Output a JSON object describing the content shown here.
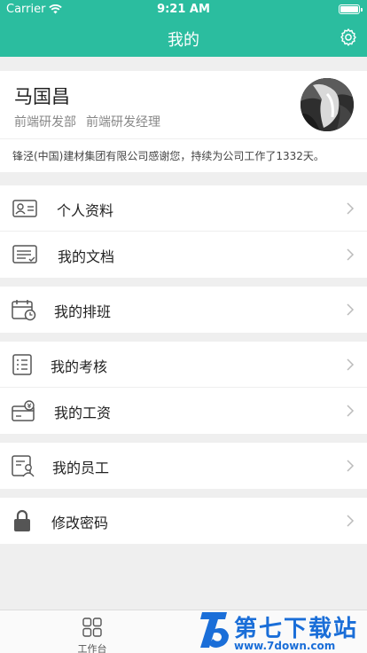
{
  "status_bar": {
    "carrier": "Carrier",
    "time": "9:21 AM",
    "battery_level": 1.0
  },
  "nav": {
    "title": "我的",
    "settings_icon": "gear-icon"
  },
  "profile": {
    "name": "马国昌",
    "department": "前端研发部",
    "position": "前端研发经理",
    "service_note": "锋泾(中国)建材集团有限公司感谢您，持续为公司工作了1332天。"
  },
  "menu": [
    {
      "label": "个人资料",
      "icon": "id-card-icon"
    },
    {
      "label": "我的文档",
      "icon": "document-icon"
    },
    {
      "label": "我的排班",
      "icon": "calendar-clock-icon"
    },
    {
      "label": "我的考核",
      "icon": "checklist-icon"
    },
    {
      "label": "我的工资",
      "icon": "salary-card-icon"
    },
    {
      "label": "我的员工",
      "icon": "employee-icon"
    },
    {
      "label": "修改密码",
      "icon": "lock-icon"
    }
  ],
  "tabbar": {
    "workbench_label": "工作台",
    "workbench_icon": "grid-icon"
  },
  "watermark": {
    "text": "第七下载站",
    "url": "www.7down.com"
  },
  "colors": {
    "accent": "#2bbd9f",
    "background": "#efefef",
    "watermark": "#1a6ed8"
  }
}
